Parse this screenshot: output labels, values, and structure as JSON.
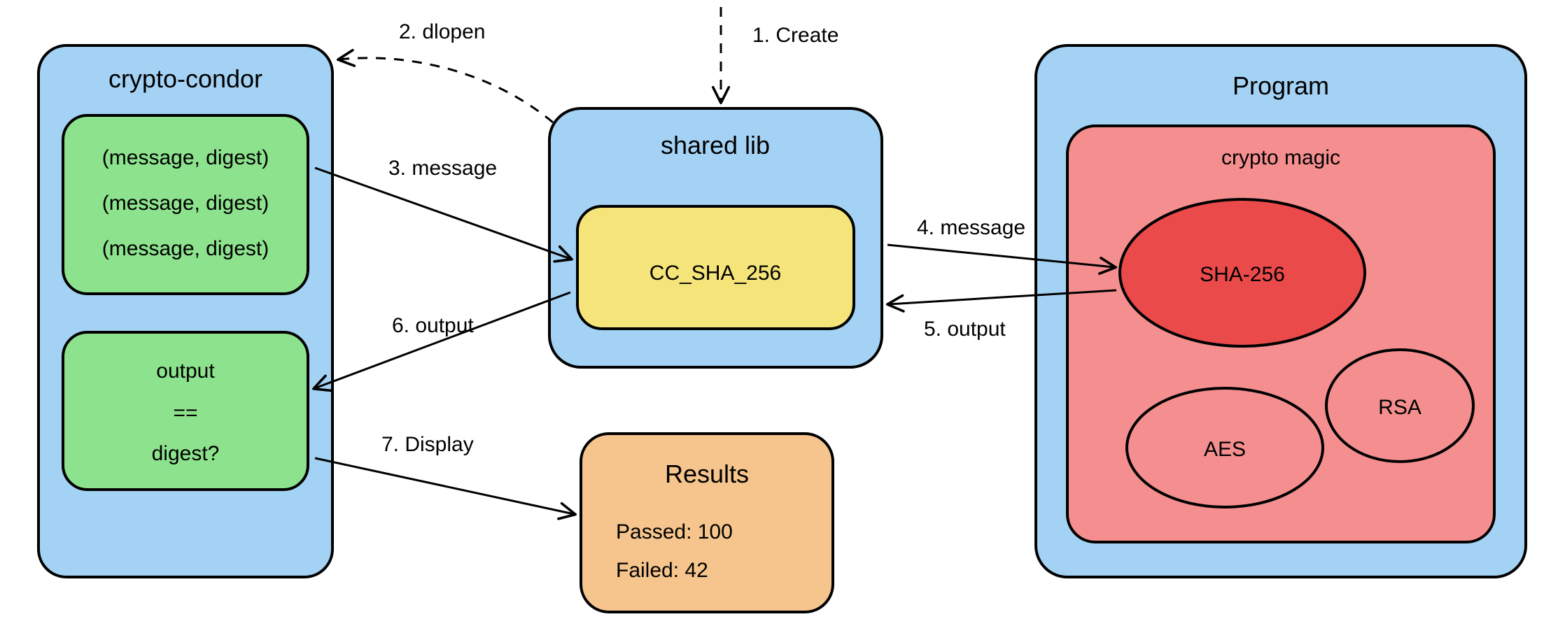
{
  "boxes": {
    "crypto_condor": {
      "title": "crypto-condor",
      "test_vectors": [
        "(message, digest)",
        "(message, digest)",
        "(message, digest)"
      ],
      "compare": [
        "output",
        "==",
        "digest?"
      ]
    },
    "shared_lib": {
      "title": "shared lib",
      "func": "CC_SHA_256"
    },
    "program": {
      "title": "Program",
      "inner_title": "crypto magic",
      "algos": {
        "sha": "SHA-256",
        "aes": "AES",
        "rsa": "RSA"
      }
    },
    "results": {
      "title": "Results",
      "passed_label": "Passed: 100",
      "failed_label": "Failed: 42"
    }
  },
  "arrows": {
    "create": "1. Create",
    "dlopen": "2. dlopen",
    "msg1": "3. message",
    "msg2": "4. message",
    "out1": "5. output",
    "out2": "6. output",
    "display": "7. Display"
  }
}
